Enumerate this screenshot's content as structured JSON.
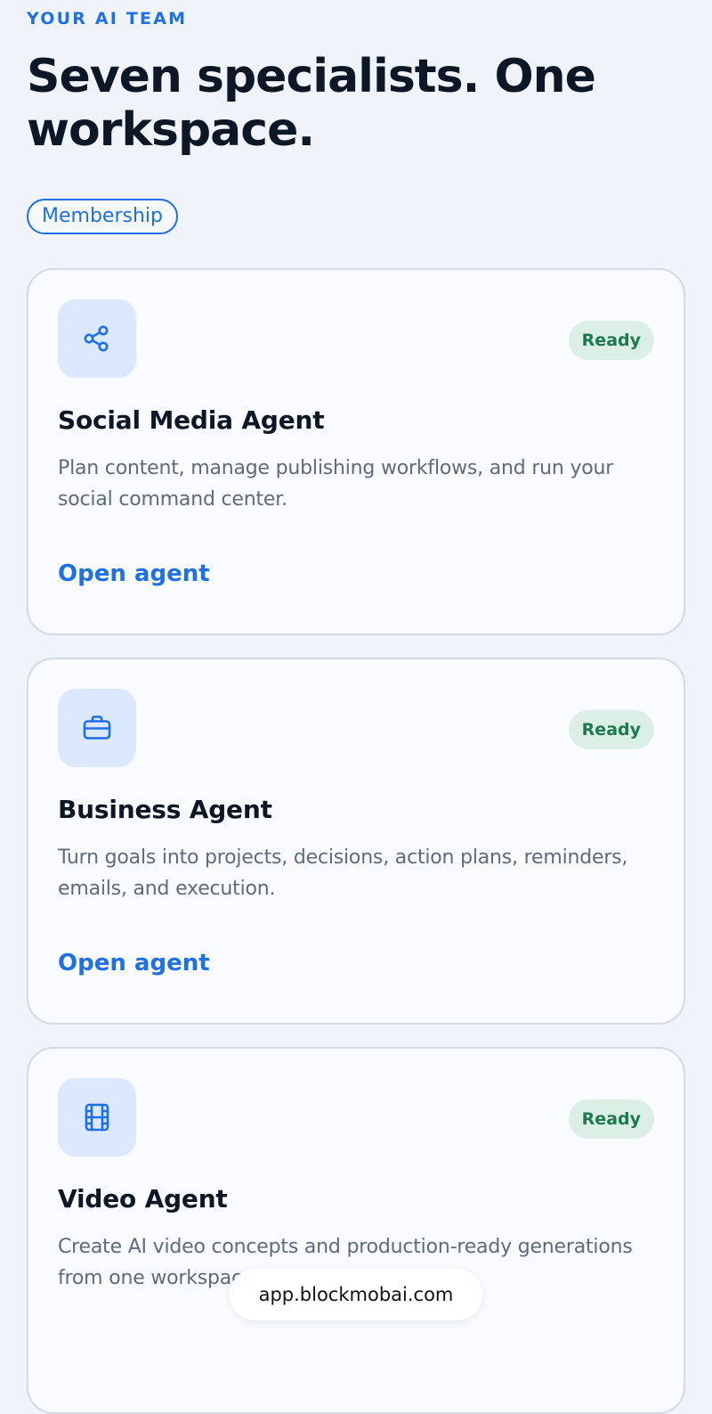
{
  "header": {
    "eyebrow": "YOUR AI TEAM",
    "headline": "Seven specialists. One workspace.",
    "membership_label": "Membership"
  },
  "agents": [
    {
      "icon": "share-icon",
      "status": "Ready",
      "title": "Social Media Agent",
      "description": "Plan content, manage publishing workflows, and run your social command center.",
      "link": "Open agent"
    },
    {
      "icon": "briefcase-icon",
      "status": "Ready",
      "title": "Business Agent",
      "description": "Turn goals into projects, decisions, action plans, reminders, emails, and execution.",
      "link": "Open agent"
    },
    {
      "icon": "film-icon",
      "status": "Ready",
      "title": "Video Agent",
      "description": "Create AI video concepts and production-ready generations from one workspace."
    }
  ],
  "browser": {
    "url": "app.blockmobai.com"
  },
  "colors": {
    "accent": "#1f6fe5",
    "ready_text": "#1d7a4e",
    "ready_bg": "#dbefe6",
    "icon_tile_bg": "#dbe8fd"
  }
}
